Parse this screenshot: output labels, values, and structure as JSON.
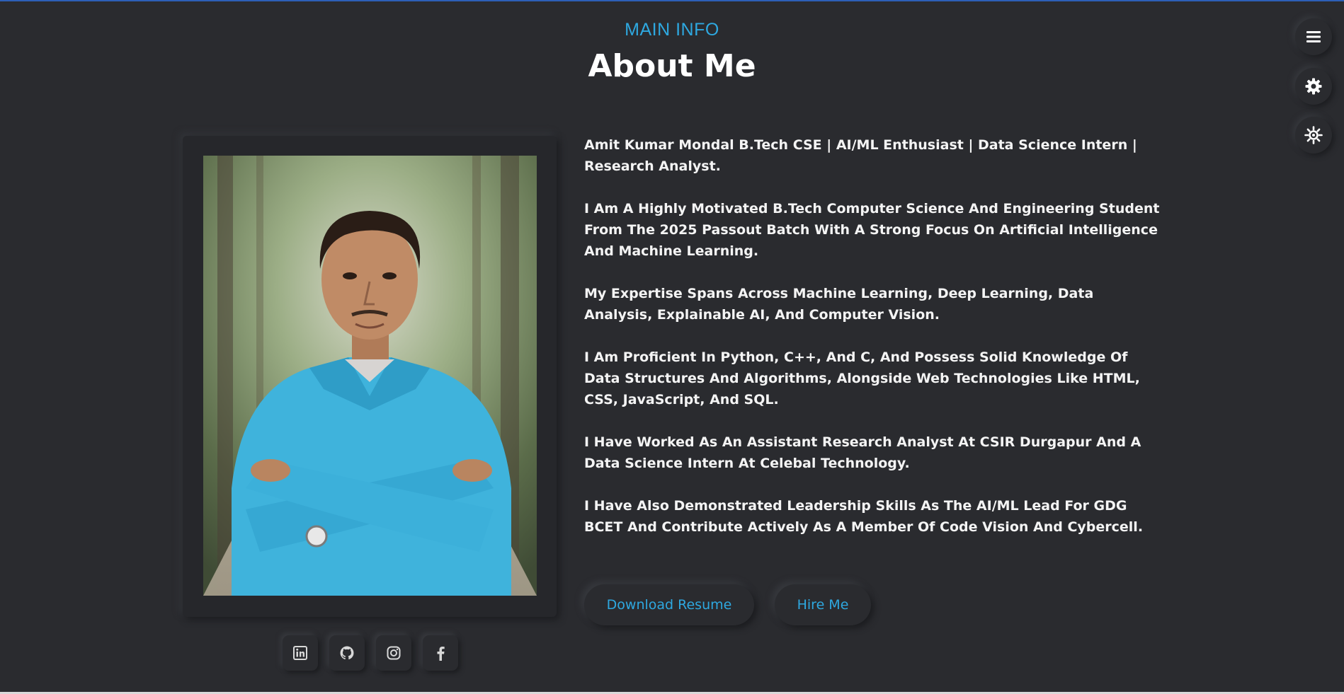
{
  "header": {
    "eyebrow": "MAIN INFO",
    "title": "About Me"
  },
  "about": {
    "photo_alt": "Portrait photo",
    "paragraphs": [
      "Amit Kumar Mondal B.Tech CSE | AI/ML Enthusiast | Data Science Intern | Research Analyst.",
      "I Am A Highly Motivated B.Tech Computer Science And Engineering Student From The 2025 Passout Batch With A Strong Focus On Artificial Intelligence And Machine Learning.",
      "My Expertise Spans Across Machine Learning, Deep Learning, Data Analysis, Explainable AI, And Computer Vision.",
      "I Am Proficient In Python, C++, And C, And Possess Solid Knowledge Of Data Structures And Algorithms, Alongside Web Technologies Like HTML, CSS, JavaScript, And SQL.",
      "I Have Worked As An Assistant Research Analyst At CSIR Durgapur And A Data Science Intern At Celebal Technology.",
      "I Have Also Demonstrated Leadership Skills As The AI/ML Lead For GDG BCET And Contribute Actively As A Member Of Code Vision And Cybercell."
    ],
    "download_resume_label": "Download Resume",
    "hire_me_label": "Hire Me"
  },
  "social_icons": [
    "linkedin-icon",
    "github-icon",
    "instagram-icon",
    "facebook-icon"
  ],
  "side_controls": [
    "menu-icon",
    "settings-gear-icon",
    "theme-sun-icon"
  ],
  "colors": {
    "background": "#2a2b2f",
    "accent": "#2ea8e0",
    "text": "#ffffff"
  }
}
